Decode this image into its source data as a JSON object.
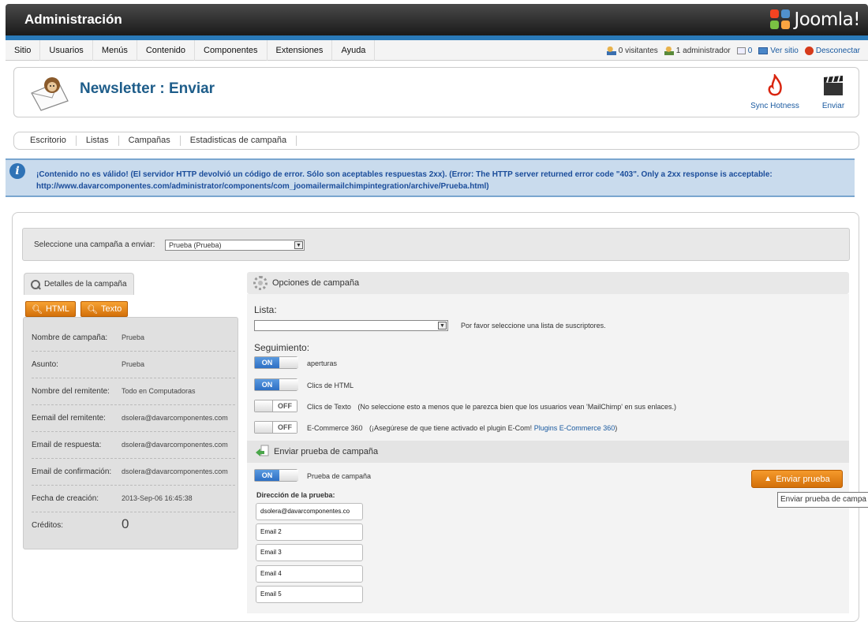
{
  "topbar": {
    "title": "Administración",
    "logo_text": "Joomla!"
  },
  "menu": [
    "Sitio",
    "Usuarios",
    "Menús",
    "Contenido",
    "Componentes",
    "Extensiones",
    "Ayuda"
  ],
  "status": {
    "visitors": "0 visitantes",
    "admins": "1 administrador",
    "messages": "0",
    "view_site": "Ver sitio",
    "logout": "Desconectar"
  },
  "header": {
    "title": "Newsletter : Enviar",
    "sync_label": "Sync Hotness",
    "send_label": "Enviar"
  },
  "subnav": [
    "Escritorio",
    "Listas",
    "Campañas",
    "Estadisticas de campaña"
  ],
  "notice": {
    "text": "¡Contenido no es válido! (El servidor HTTP devolvió un código de error. Sólo son aceptables respuestas 2xx). (Error: The HTTP server returned error code \"403\". Only a 2xx response is acceptable: http://www.davarcomponentes.com/administrator/components/com_joomailermailchimpintegration/archive/Prueba.html)"
  },
  "campaign_select": {
    "label": "Seleccione una campaña a enviar:",
    "value": "Prueba (Prueba)"
  },
  "details": {
    "tab_label": "Detalles de la campaña",
    "html_btn": "HTML",
    "text_btn": "Texto",
    "rows": [
      {
        "key": "Nombre de campaña:",
        "value": "Prueba"
      },
      {
        "key": "Asunto:",
        "value": "Prueba"
      },
      {
        "key": "Nombre del remitente:",
        "value": "Todo en Computadoras"
      },
      {
        "key": "Eemail del remitente:",
        "value": "dsolera@davarcomponentes.com"
      },
      {
        "key": "Email de respuesta:",
        "value": "dsolera@davarcomponentes.com"
      },
      {
        "key": "Email de confirmación:",
        "value": "dsolera@davarcomponentes.com"
      },
      {
        "key": "Fecha de creación:",
        "value": "2013-Sep-06 16:45:38"
      },
      {
        "key": "Créditos:",
        "value": "0"
      }
    ]
  },
  "options": {
    "header": "Opciones de campaña",
    "list_label": "Lista:",
    "list_hint": "Por favor seleccione una lista de suscriptores.",
    "tracking_label": "Seguimiento:",
    "toggles": [
      {
        "state": "ON",
        "label": "aperturas"
      },
      {
        "state": "ON",
        "label": "Clics de HTML"
      },
      {
        "state": "OFF",
        "label": "Clics de Texto"
      },
      {
        "state": "OFF",
        "label": "E-Commerce 360"
      }
    ],
    "text_clicks_note": "(No seleccione esto a menos que le parezca bien que los usuarios vean 'MailChimp' en sus enlaces.)",
    "ecommerce_note_pre": "(¡Asegúrese de que tiene activado el plugin E-Com!",
    "ecommerce_link": "Plugins E-Commerce 360",
    "ecommerce_note_post": ")"
  },
  "test": {
    "header": "Enviar prueba de campaña",
    "toggle_state": "ON",
    "toggle_label": "Prueba de campaña",
    "address_label": "Dirección de la prueba:",
    "emails": [
      "dsolera@davarcomponentes.co",
      "Email 2",
      "Email 3",
      "Email 4",
      "Email 5"
    ],
    "send_button": "Enviar prueba",
    "tooltip": "Enviar prueba de campa"
  }
}
